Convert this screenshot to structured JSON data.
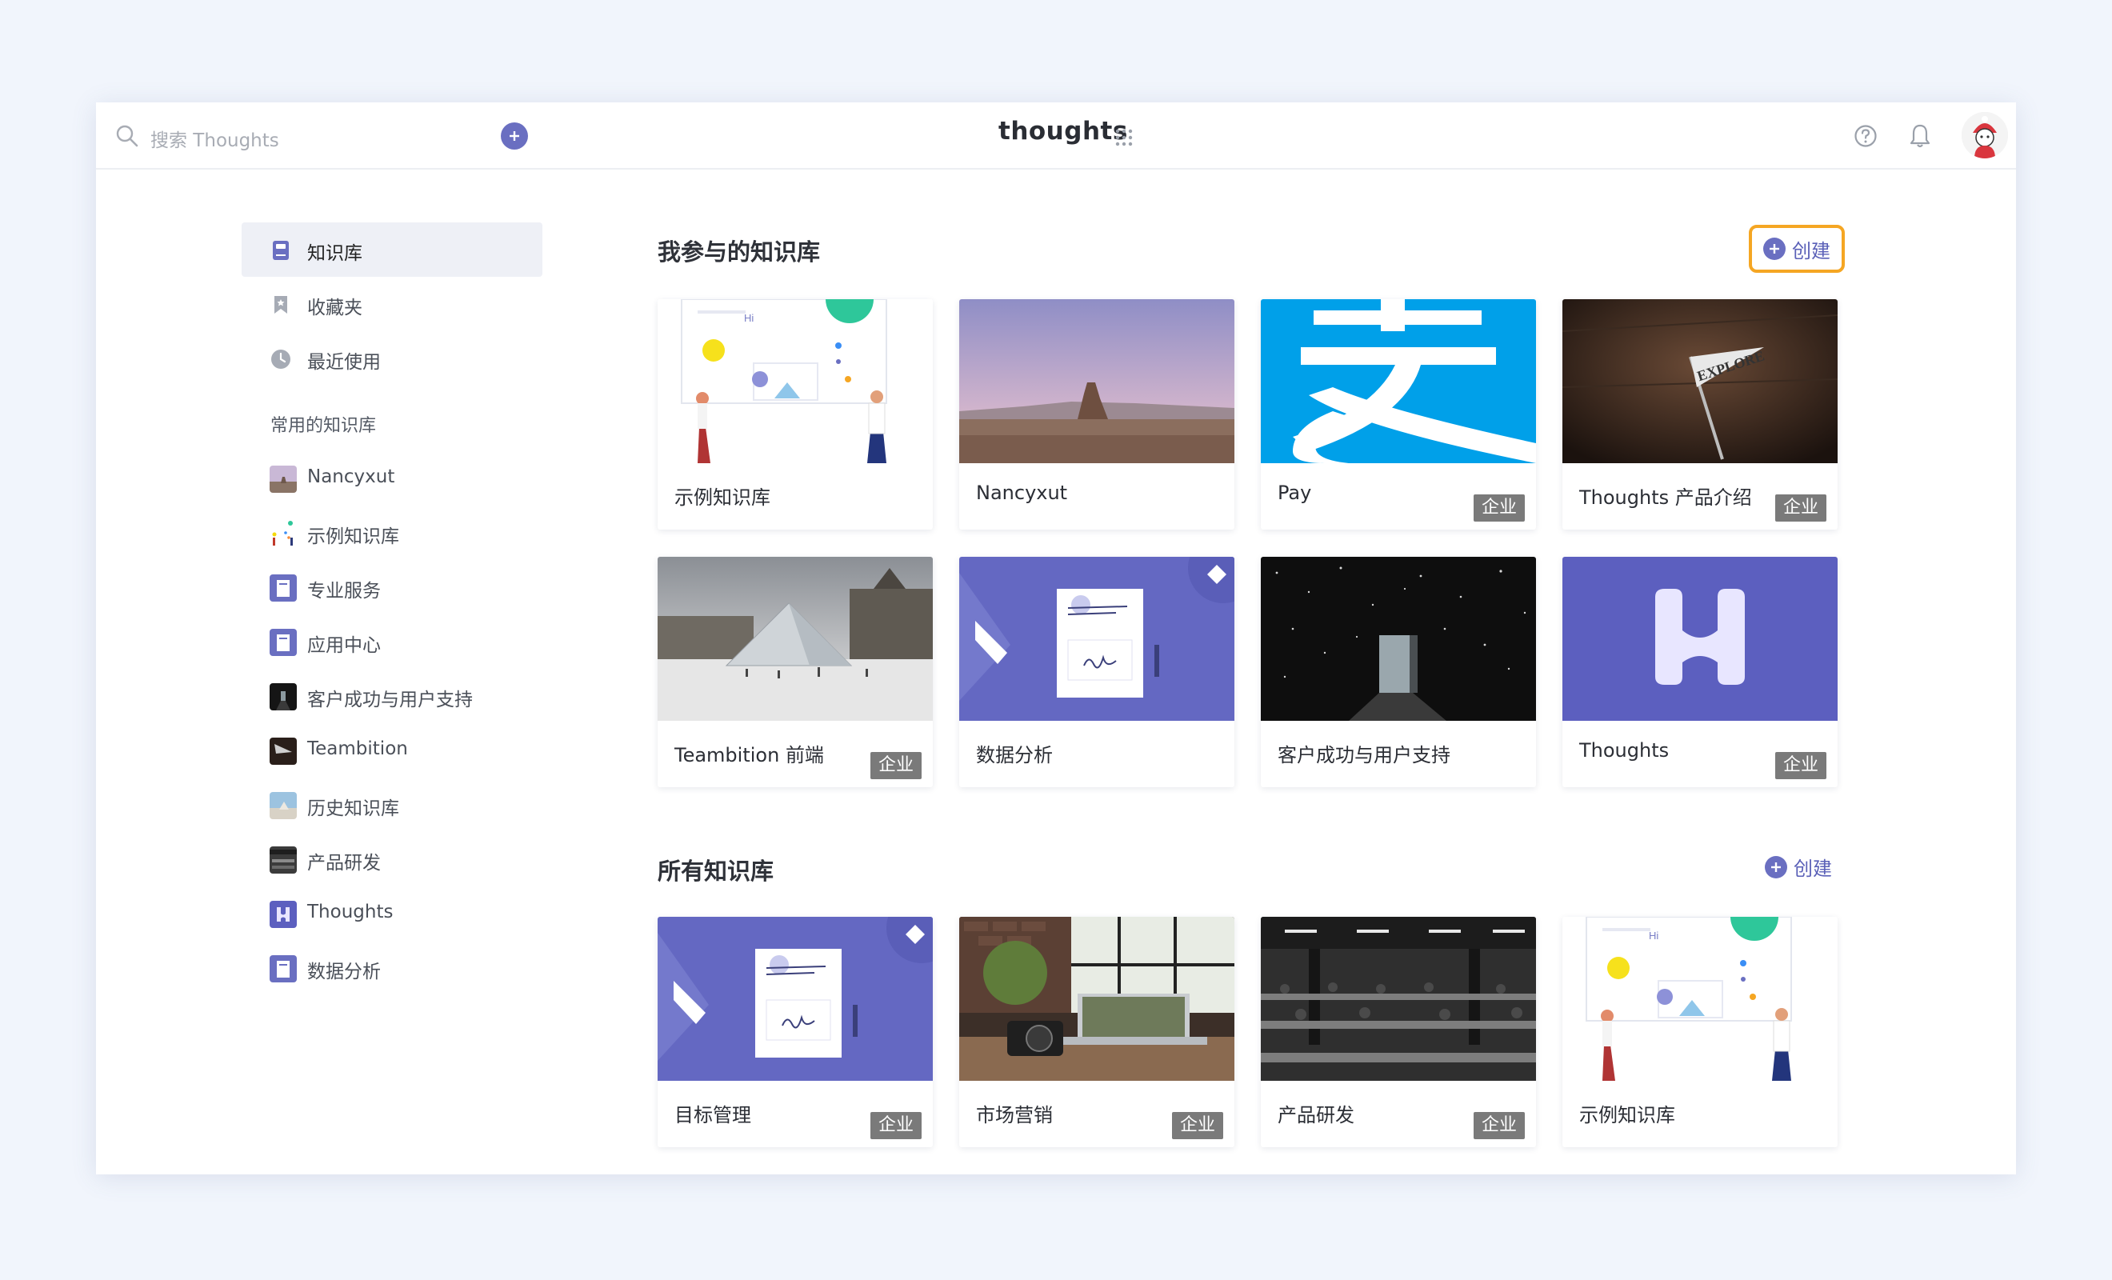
{
  "header": {
    "search_placeholder": "搜索 Thoughts",
    "brand": "thoughts",
    "colors": {
      "accent": "#6a6fc1",
      "highlight_border": "#f5a623"
    }
  },
  "sidebar": {
    "nav": [
      {
        "label": "知识库",
        "icon": "book-icon",
        "active": true
      },
      {
        "label": "收藏夹",
        "icon": "bookmark-icon",
        "active": false
      },
      {
        "label": "最近使用",
        "icon": "clock-icon",
        "active": false
      }
    ],
    "frequent_title": "常用的知识库",
    "frequent": [
      {
        "label": "Nancyxut",
        "thumb": "desert"
      },
      {
        "label": "示例知识库",
        "thumb": "dots"
      },
      {
        "label": "专业服务",
        "thumb": "doc"
      },
      {
        "label": "应用中心",
        "thumb": "doc"
      },
      {
        "label": "客户成功与用户支持",
        "thumb": "dark"
      },
      {
        "label": "Teambition",
        "thumb": "wood"
      },
      {
        "label": "历史知识库",
        "thumb": "sky"
      },
      {
        "label": "产品研发",
        "thumb": "office"
      },
      {
        "label": "Thoughts",
        "thumb": "logo"
      },
      {
        "label": "数据分析",
        "thumb": "doc"
      }
    ]
  },
  "main": {
    "participated": {
      "title": "我参与的知识库",
      "create_label": "创建",
      "cards": [
        {
          "name": "示例知识库",
          "badge": ""
        },
        {
          "name": "Nancyxut",
          "badge": ""
        },
        {
          "name": "Pay",
          "badge": "企业"
        },
        {
          "name": "Thoughts 产品介绍",
          "badge": "企业"
        },
        {
          "name": "Teambition 前端",
          "badge": "企业"
        },
        {
          "name": "数据分析",
          "badge": ""
        },
        {
          "name": "客户成功与用户支持",
          "badge": ""
        },
        {
          "name": "Thoughts",
          "badge": "企业"
        }
      ]
    },
    "all": {
      "title": "所有知识库",
      "create_label": "创建",
      "cards": [
        {
          "name": "目标管理",
          "badge": "企业"
        },
        {
          "name": "市场营销",
          "badge": "企业"
        },
        {
          "name": "产品研发",
          "badge": "企业"
        },
        {
          "name": "示例知识库",
          "badge": ""
        }
      ]
    }
  }
}
